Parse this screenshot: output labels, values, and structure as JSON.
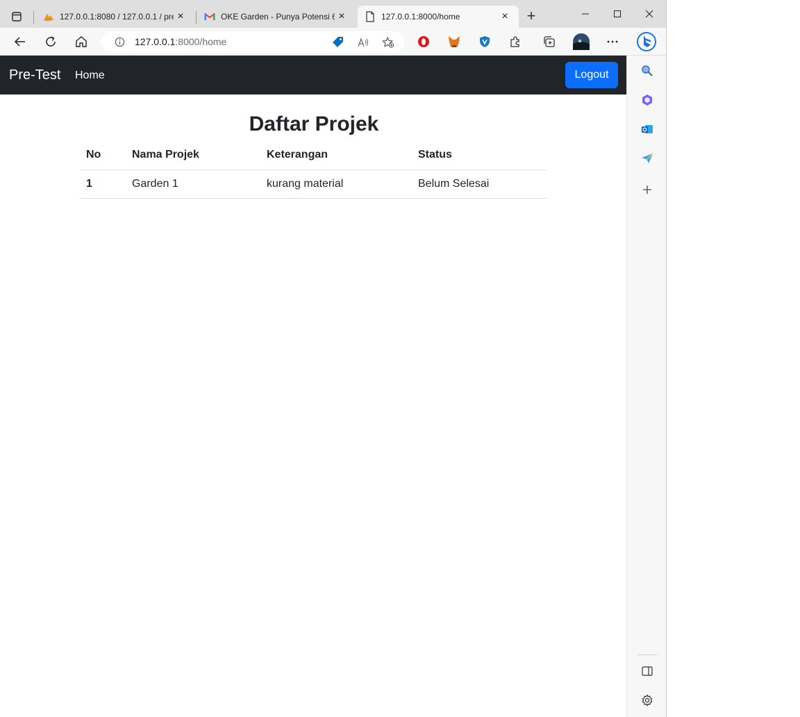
{
  "browser": {
    "tabs": [
      {
        "title": "127.0.0.1:8080 / 127.0.0.1 / pre_",
        "favicon": "phpmyadmin-icon"
      },
      {
        "title": "OKE Garden - Punya Potensi 6 -",
        "favicon": "gmail-icon"
      },
      {
        "title": "127.0.0.1:8000/home",
        "favicon": "page-icon",
        "active": true
      }
    ],
    "address": {
      "host": "127.0.0.1",
      "rest": ":8000/home"
    }
  },
  "navbar": {
    "brand": "Pre-Test",
    "home_link": "Home",
    "logout_label": "Logout"
  },
  "main": {
    "title": "Daftar Projek",
    "table": {
      "headers": [
        "No",
        "Nama Projek",
        "Keterangan",
        "Status"
      ],
      "rows": [
        {
          "no": "1",
          "nama": "Garden 1",
          "keterangan": "kurang material",
          "status": "Belum Selesai"
        }
      ]
    }
  },
  "colors": {
    "navbar_bg": "#212529",
    "primary_button": "#0d6efd"
  }
}
